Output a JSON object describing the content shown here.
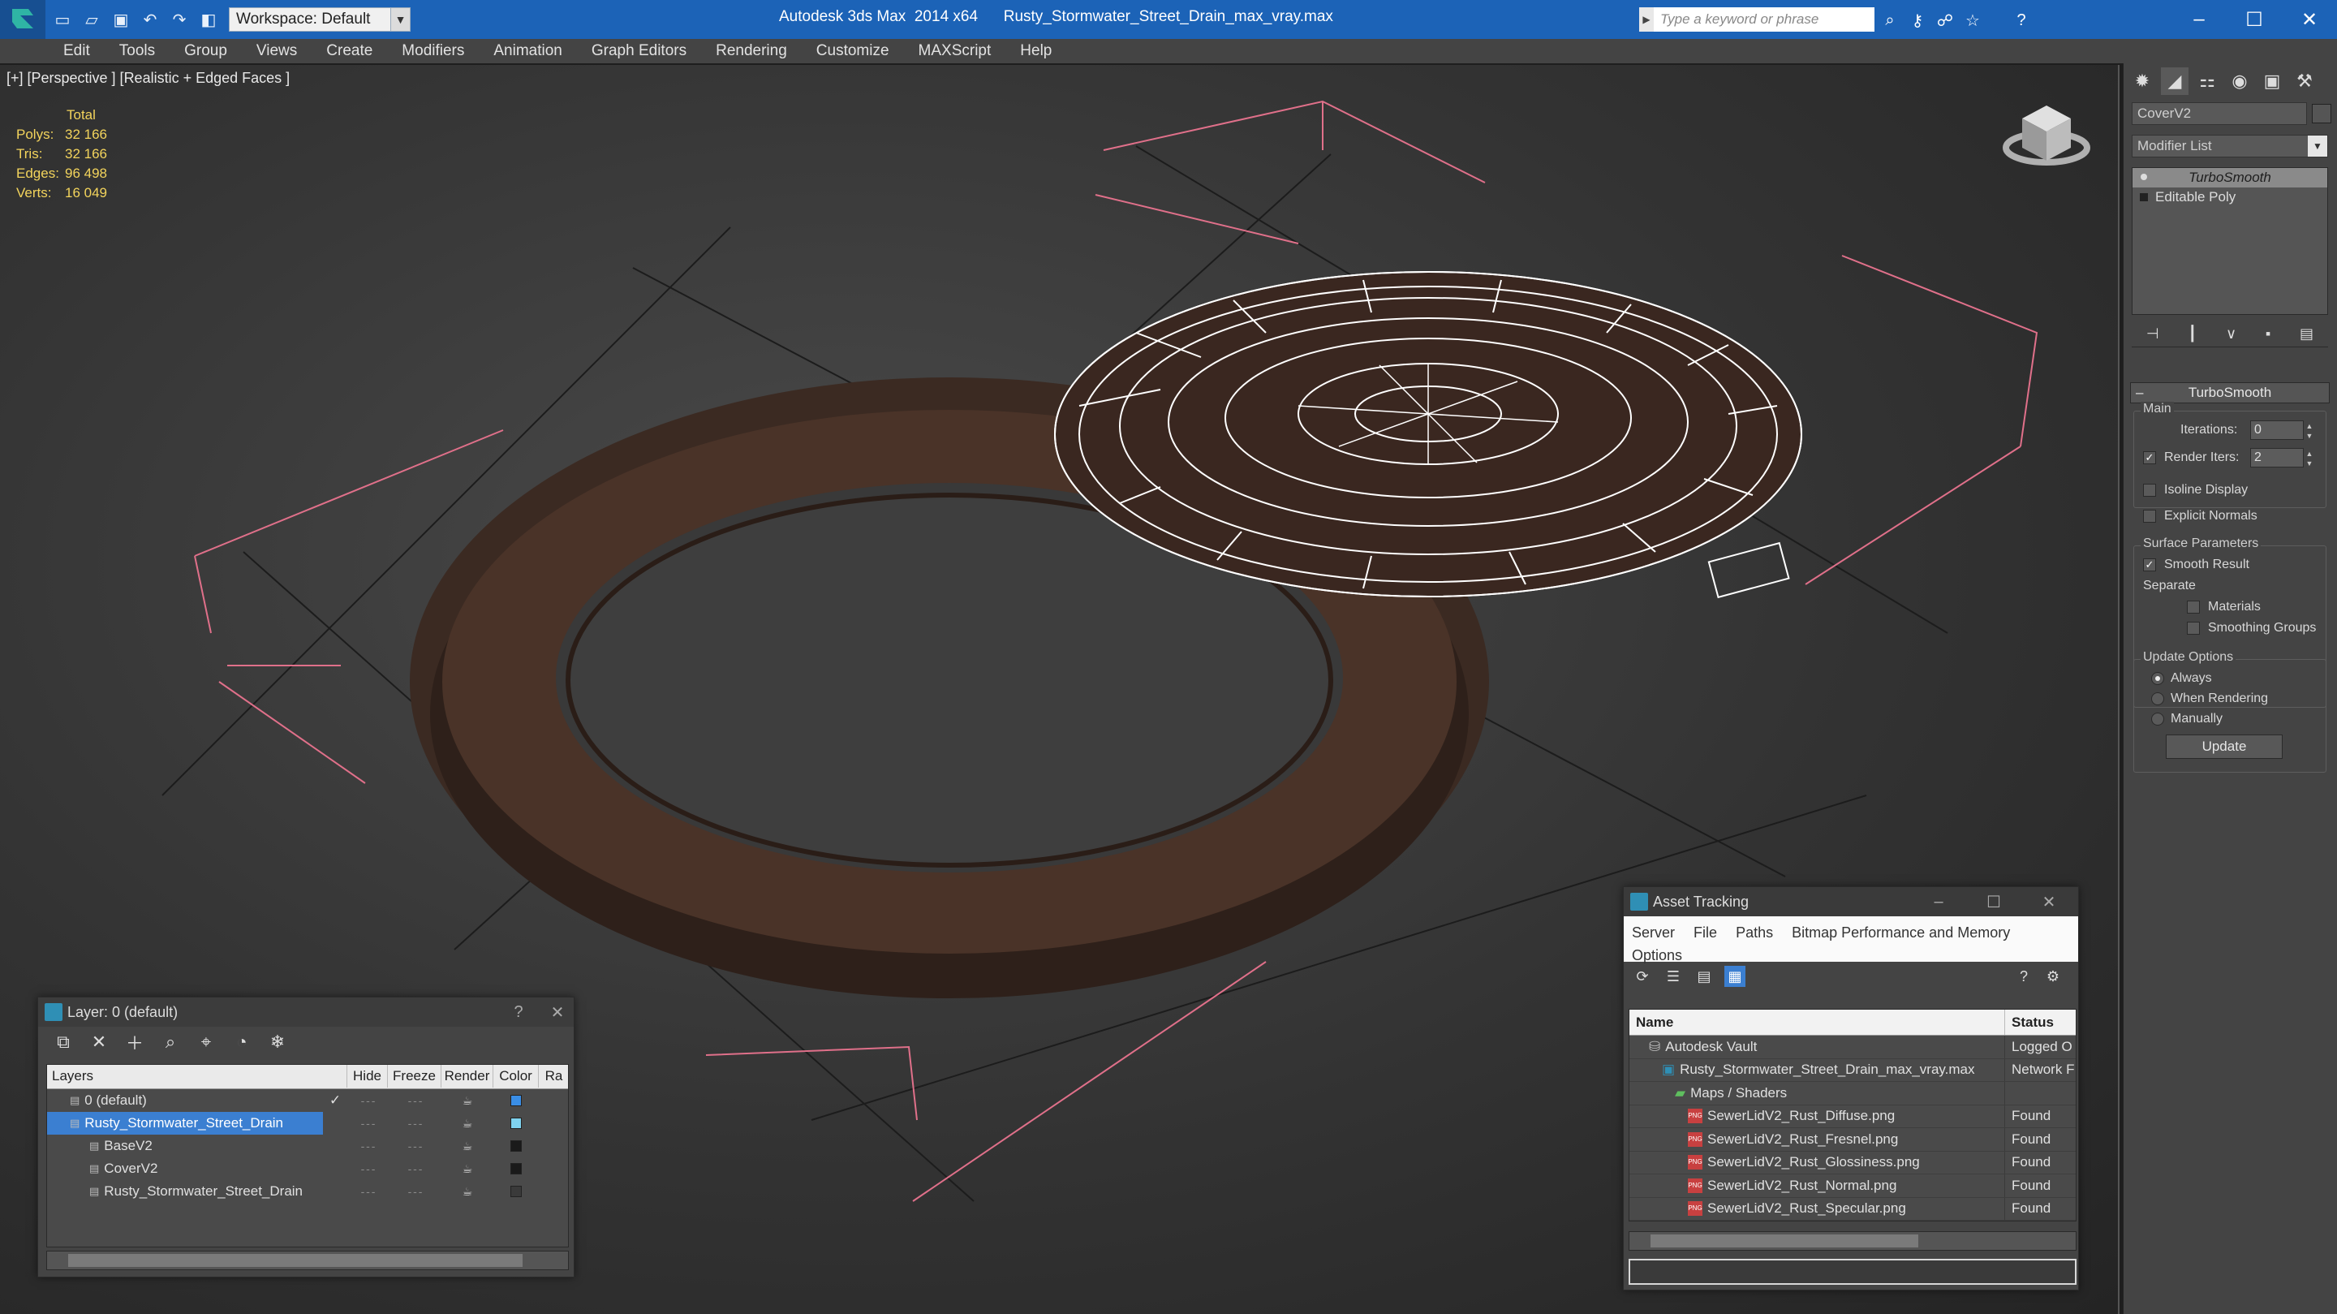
{
  "titlebar": {
    "workspace": "Workspace: Default",
    "app_title": "Autodesk 3ds Max  2014 x64",
    "file_title": "Rusty_Stormwater_Street_Drain_max_vray.max",
    "search_placeholder": "Type a keyword or phrase",
    "colors": {
      "bar": "#1c63b7"
    }
  },
  "menubar": {
    "items": [
      "Edit",
      "Tools",
      "Group",
      "Views",
      "Create",
      "Modifiers",
      "Animation",
      "Graph Editors",
      "Rendering",
      "Customize",
      "MAXScript",
      "Help"
    ]
  },
  "viewport": {
    "label": "[+] [Perspective ] [Realistic + Edged Faces ]",
    "stats": {
      "header": "Total",
      "rows": [
        {
          "label": "Polys:",
          "value": "32 166"
        },
        {
          "label": "Tris:",
          "value": "32 166"
        },
        {
          "label": "Edges:",
          "value": "96 498"
        },
        {
          "label": "Verts:",
          "value": "16 049"
        }
      ]
    }
  },
  "command_panel": {
    "object_name": "CoverV2",
    "modifier_list": "Modifier List",
    "stack": [
      "TurboSmooth",
      "Editable Poly"
    ],
    "rollout_title": "TurboSmooth",
    "main_group": "Main",
    "iterations_label": "Iterations:",
    "iterations_value": "0",
    "render_iters_label": "Render Iters:",
    "render_iters_value": "2",
    "render_iters_checked": true,
    "isoline_label": "Isoline Display",
    "explicit_label": "Explicit Normals",
    "surface_group": "Surface Parameters",
    "smooth_result_label": "Smooth Result",
    "separate_label": "Separate",
    "materials_label": "Materials",
    "smoothing_groups_label": "Smoothing Groups",
    "update_group": "Update Options",
    "always_label": "Always",
    "when_rendering_label": "When Rendering",
    "manually_label": "Manually",
    "update_button": "Update"
  },
  "layer_window": {
    "title": "Layer: 0 (default)",
    "help": "?",
    "columns": [
      "Layers",
      "Hide",
      "Freeze",
      "Render",
      "Color",
      "Ra"
    ],
    "rows": [
      {
        "name": "0 (default)",
        "indent": 0,
        "color": "#3a8ee6",
        "selected": false,
        "check": "✓"
      },
      {
        "name": "Rusty_Stormwater_Street_Drain",
        "indent": 0,
        "color": "#7fd3f0",
        "selected": true,
        "check": ""
      },
      {
        "name": "BaseV2",
        "indent": 1,
        "color": "#1a1a1a",
        "selected": false,
        "check": ""
      },
      {
        "name": "CoverV2",
        "indent": 1,
        "color": "#1a1a1a",
        "selected": false,
        "check": ""
      },
      {
        "name": "Rusty_Stormwater_Street_Drain",
        "indent": 1,
        "color": "#3a3a3a",
        "selected": false,
        "check": ""
      }
    ]
  },
  "asset_window": {
    "title": "Asset Tracking",
    "menu": [
      "Server",
      "File",
      "Paths",
      "Bitmap Performance and Memory",
      "Options"
    ],
    "columns": [
      "Name",
      "Status"
    ],
    "rows": [
      {
        "name": "Autodesk Vault",
        "indent": 1,
        "status": "Logged O",
        "icon": "vault"
      },
      {
        "name": "Rusty_Stormwater_Street_Drain_max_vray.max",
        "indent": 2,
        "status": "Network F",
        "icon": "max"
      },
      {
        "name": "Maps / Shaders",
        "indent": 3,
        "status": "",
        "icon": "folder"
      },
      {
        "name": "SewerLidV2_Rust_Diffuse.png",
        "indent": 4,
        "status": "Found",
        "icon": "png"
      },
      {
        "name": "SewerLidV2_Rust_Fresnel.png",
        "indent": 4,
        "status": "Found",
        "icon": "png"
      },
      {
        "name": "SewerLidV2_Rust_Glossiness.png",
        "indent": 4,
        "status": "Found",
        "icon": "png"
      },
      {
        "name": "SewerLidV2_Rust_Normal.png",
        "indent": 4,
        "status": "Found",
        "icon": "png"
      },
      {
        "name": "SewerLidV2_Rust_Specular.png",
        "indent": 4,
        "status": "Found",
        "icon": "png"
      }
    ]
  }
}
